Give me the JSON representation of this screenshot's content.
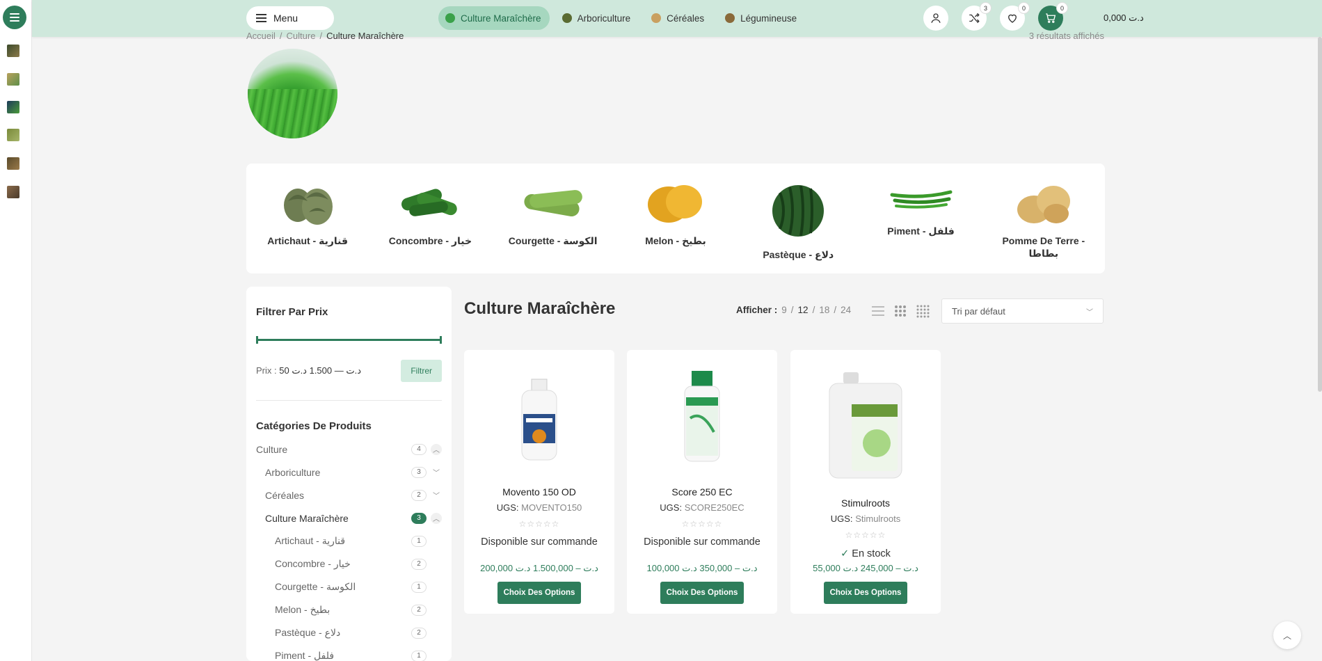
{
  "header": {
    "menu_label": "Menu",
    "nav": [
      {
        "label": "Culture Maraîchère",
        "active": true,
        "color": "#3aa14a"
      },
      {
        "label": "Arboriculture",
        "active": false,
        "color": "#5a6b32"
      },
      {
        "label": "Céréales",
        "active": false,
        "color": "#c9a060"
      },
      {
        "label": "Légumineuse",
        "active": false,
        "color": "#8a6a3a"
      }
    ],
    "compare_count": "3",
    "wishlist_count": "0",
    "cart_count": "0",
    "cart_total": "0,000 د.ت"
  },
  "breadcrumb": {
    "items": [
      "Accueil",
      "Culture",
      "Culture Maraîchère"
    ],
    "results": "3 résultats affichés"
  },
  "subcategories": [
    {
      "name": "Artichaut - قنارية",
      "icon": "artichoke-image"
    },
    {
      "name": "Concombre - خيار",
      "icon": "cucumber-image"
    },
    {
      "name": "Courgette - الكوسة",
      "icon": "zucchini-image"
    },
    {
      "name": "Melon - بطيخ",
      "icon": "melon-image"
    },
    {
      "name": "Pastèque - دلاع",
      "icon": "watermelon-image"
    },
    {
      "name": "Piment - فلفل",
      "icon": "pepper-image"
    },
    {
      "name": "Pomme De Terre - بطاطا",
      "icon": "potato-image"
    }
  ],
  "sidebar": {
    "price_title": "Filtrer Par Prix",
    "price_prefix": "Prix :",
    "price_range": "50 د.ت — 1.500 د.ت",
    "filter_label": "Filtrer",
    "categories_title": "Catégories De Produits",
    "categories": [
      {
        "name": "Culture",
        "count": "4"
      },
      {
        "name": "Arboriculture",
        "count": "3"
      },
      {
        "name": "Céréales",
        "count": "2"
      },
      {
        "name": "Culture Maraîchère",
        "count": "3"
      },
      {
        "name": "Artichaut - قنارية",
        "count": "1"
      },
      {
        "name": "Concombre - خيار",
        "count": "2"
      },
      {
        "name": "Courgette - الكوسة",
        "count": "1"
      },
      {
        "name": "Melon - بطيخ",
        "count": "2"
      },
      {
        "name": "Pastèque - دلاع",
        "count": "2"
      },
      {
        "name": "Piment - فلفل",
        "count": "1"
      }
    ]
  },
  "main": {
    "title": "Culture Maraîchère",
    "per_page_label": "Afficher :",
    "per_page_options": [
      "9",
      "12",
      "18",
      "24"
    ],
    "sort_label": "Tri par défaut",
    "sku_label": "UGS:",
    "stars": "☆☆☆☆☆",
    "button_label": "Choix Des Options",
    "products": [
      {
        "name": "Movento 150 OD",
        "sku": "MOVENTO150",
        "availability": "Disponible sur commande",
        "price": "200,000 د.ت – 1.500,000 د.ت"
      },
      {
        "name": "Score 250 EC",
        "sku": "SCORE250EC",
        "availability": "Disponible sur commande",
        "price": "100,000 د.ت – 350,000 د.ت"
      },
      {
        "name": "Stimulroots",
        "sku": "Stimulroots",
        "availability": "En stock",
        "price": "55,000 د.ت – 245,000 د.ت"
      }
    ]
  }
}
